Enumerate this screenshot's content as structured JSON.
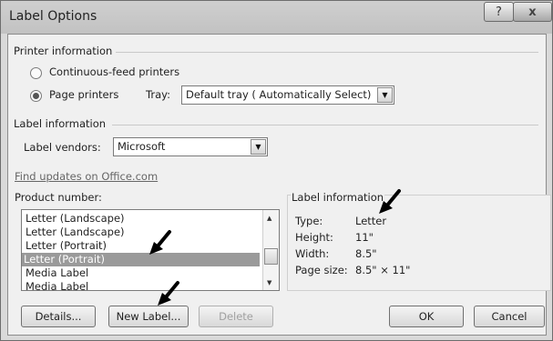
{
  "window": {
    "title": "Label Options",
    "help_glyph": "?",
    "close_glyph": "x"
  },
  "printer_information": {
    "heading": "Printer information",
    "continuous_label": "Continuous-feed printers",
    "page_label": "Page printers",
    "selected": "page",
    "tray_label": "Tray:",
    "tray_value": "Default tray ( Automatically Select)"
  },
  "label_information_section": {
    "heading": "Label information",
    "vendors_label": "Label vendors:",
    "vendors_value": "Microsoft",
    "find_updates_link": "Find updates on Office.com"
  },
  "product_number": {
    "heading": "Product number:",
    "items": [
      "Letter (Landscape)",
      "Letter (Landscape)",
      "Letter (Portrait)",
      "Letter (Portrait)",
      "Media Label",
      "Media Label"
    ],
    "selected_index": 3
  },
  "label_info_panel": {
    "heading": "Label information",
    "rows": [
      {
        "key": "Type:",
        "value": "Letter"
      },
      {
        "key": "Height:",
        "value": "11\""
      },
      {
        "key": "Width:",
        "value": "8.5\""
      },
      {
        "key": "Page size:",
        "value": "8.5\" × 11\""
      }
    ]
  },
  "buttons": {
    "details": "Details...",
    "new_label": "New Label...",
    "delete": "Delete",
    "ok": "OK",
    "cancel": "Cancel"
  },
  "icons": [
    "help-icon",
    "close-icon",
    "dropdown-arrow-icon",
    "scroll-up-icon",
    "scroll-down-icon",
    "annotation-arrow-icon"
  ]
}
